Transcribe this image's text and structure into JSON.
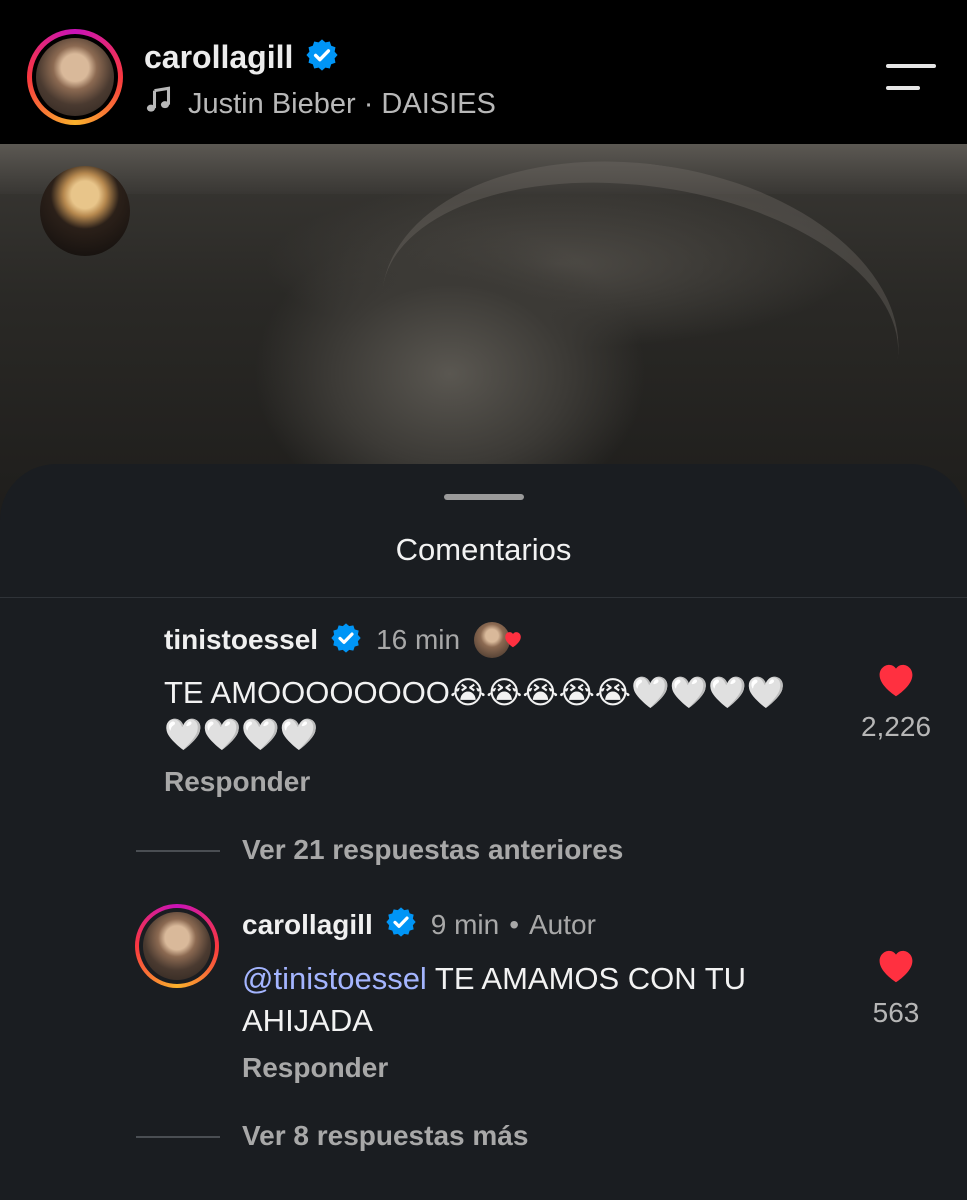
{
  "header": {
    "username": "carollagill",
    "music": "Justin Bieber · DAISIES"
  },
  "sheet": {
    "title": "Comentarios"
  },
  "comments": [
    {
      "username": "tinistoessel",
      "time": "16 min",
      "text": "TE AMOOOOOOOO😭😭😭😭😭🤍🤍🤍🤍🤍🤍🤍🤍",
      "likes": "2,226",
      "reply_label": "Responder",
      "view_replies": "Ver 21 respuestas anteriores"
    },
    {
      "username": "carollagill",
      "time": "9 min",
      "author_label": "Autor",
      "mention": "@tinistoessel",
      "text": " TE AMAMOS CON TU AHIJADA",
      "likes": "563",
      "reply_label": "Responder",
      "view_more": "Ver 8 respuestas más"
    }
  ],
  "colors": {
    "sheet_bg": "#1a1d21",
    "heart": "#ff3040",
    "verified": "#0095f6",
    "mention": "#a4b5ff"
  },
  "icons": [
    "verified-badge-icon",
    "music-note-icon",
    "menu-icon",
    "heart-icon"
  ]
}
